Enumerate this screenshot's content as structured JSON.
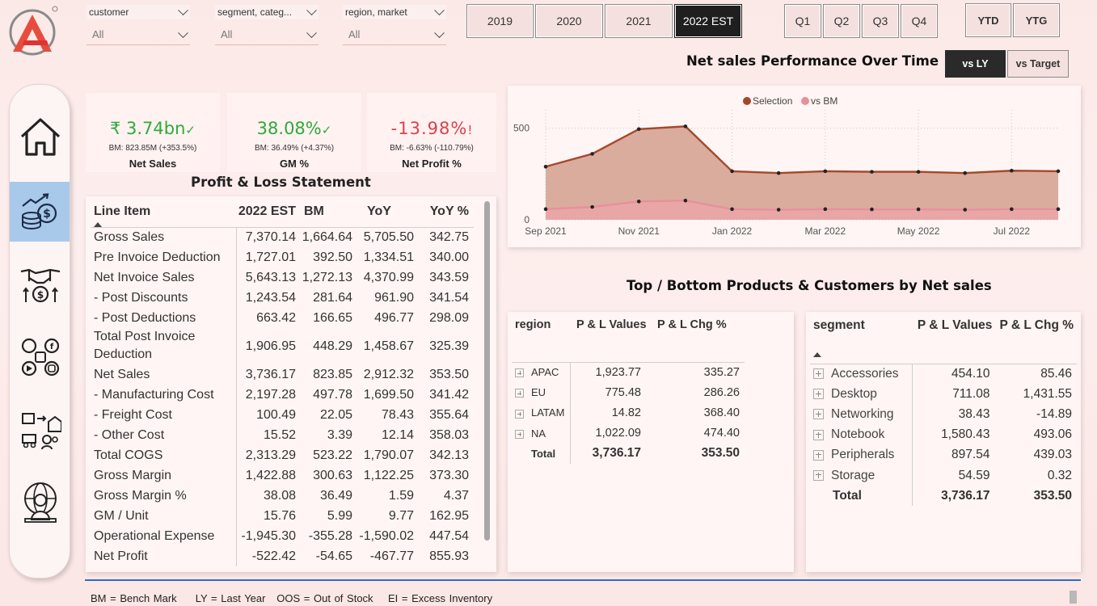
{
  "filters": [
    {
      "label": "customer",
      "value": "All"
    },
    {
      "label": "segment, categ...",
      "value": "All"
    },
    {
      "label": "region, market",
      "value": "All"
    }
  ],
  "years": [
    "2019",
    "2020",
    "2021",
    "2022 EST"
  ],
  "selected_year": "2022 EST",
  "quarters": [
    "Q1",
    "Q2",
    "Q3",
    "Q4"
  ],
  "periods": [
    "YTD",
    "YTG"
  ],
  "compare": {
    "options": [
      "vs LY",
      "vs Target"
    ],
    "selected": "vs LY"
  },
  "kpis": [
    {
      "value": "₹ 3.74bn",
      "indicator": "✓",
      "bm": "BM: 823.85M (+353.5%)",
      "name": "Net Sales",
      "color": "#2eaa3c"
    },
    {
      "value": "38.08%",
      "indicator": "✓",
      "bm": "BM: 36.49% (+4.37%)",
      "name": "GM %",
      "color": "#2eaa3c"
    },
    {
      "value": "-13.98%",
      "indicator": "!",
      "bm": "BM: -6.63% (-110.79%)",
      "name": "Net Profit %",
      "color": "#e0404a"
    }
  ],
  "pl": {
    "title": "Profit & Loss Statement",
    "columns": [
      "Line Item",
      "2022 EST",
      "BM",
      "YoY",
      "YoY %"
    ],
    "rows": [
      [
        "Gross Sales",
        "7,370.14",
        "1,664.64",
        "5,705.50",
        "342.75"
      ],
      [
        "Pre Invoice Deduction",
        "1,727.01",
        "392.50",
        "1,334.51",
        "340.00"
      ],
      [
        "Net Invoice Sales",
        "5,643.13",
        "1,272.13",
        "4,370.99",
        "343.59"
      ],
      [
        "- Post Discounts",
        "1,243.54",
        "281.64",
        "961.90",
        "341.54"
      ],
      [
        "- Post Deductions",
        "663.42",
        "166.65",
        "496.77",
        "298.09"
      ],
      [
        "Total Post Invoice Deduction",
        "1,906.95",
        "448.29",
        "1,458.67",
        "325.39"
      ],
      [
        "Net Sales",
        "3,736.17",
        "823.85",
        "2,912.32",
        "353.50"
      ],
      [
        "- Manufacturing Cost",
        "2,197.28",
        "497.78",
        "1,699.50",
        "341.42"
      ],
      [
        "- Freight Cost",
        "100.49",
        "22.05",
        "78.43",
        "355.64"
      ],
      [
        "- Other Cost",
        "15.52",
        "3.39",
        "12.14",
        "358.03"
      ],
      [
        "Total COGS",
        "2,313.29",
        "523.22",
        "1,790.07",
        "342.13"
      ],
      [
        "Gross Margin",
        "1,422.88",
        "300.63",
        "1,122.25",
        "373.30"
      ],
      [
        "Gross Margin %",
        "38.08",
        "36.49",
        "1.59",
        "4.37"
      ],
      [
        "GM / Unit",
        "15.76",
        "5.99",
        "9.77",
        "162.95"
      ],
      [
        "Operational Expense",
        "-1,945.30",
        "-355.28",
        "-1,590.02",
        "447.54"
      ],
      [
        "Net Profit",
        "-522.42",
        "-54.65",
        "-467.77",
        "855.93"
      ]
    ]
  },
  "chart_title": "Net sales Performance Over Time",
  "chart_data": {
    "type": "area",
    "title": "Net sales Performance Over Time",
    "x": [
      "Sep 2021",
      "Oct 2021",
      "Nov 2021",
      "Dec 2021",
      "Jan 2022",
      "Feb 2022",
      "Mar 2022",
      "Apr 2022",
      "May 2022",
      "Jun 2022",
      "Jul 2022",
      "Aug 2022"
    ],
    "xticks": [
      "Sep 2021",
      "Nov 2021",
      "Jan 2022",
      "Mar 2022",
      "May 2022",
      "Jul 2022"
    ],
    "yticks": [
      0,
      500
    ],
    "ylim": [
      0,
      600
    ],
    "series": [
      {
        "name": "Selection",
        "color": "#a5482a",
        "values": [
          290,
          360,
          495,
          510,
          265,
          255,
          265,
          262,
          262,
          255,
          268,
          265
        ]
      },
      {
        "name": "vs BM",
        "color": "#e8909a",
        "values": [
          58,
          70,
          100,
          105,
          58,
          55,
          58,
          57,
          57,
          55,
          58,
          58
        ]
      }
    ],
    "legend": "top-center"
  },
  "tb_title": "Top / Bottom Products & Customers by Net sales",
  "region_table": {
    "columns": [
      "region",
      "P & L Values",
      "P & L Chg %"
    ],
    "rows": [
      [
        "APAC",
        "1,923.77",
        "335.27"
      ],
      [
        "EU",
        "775.48",
        "286.26"
      ],
      [
        "LATAM",
        "14.82",
        "368.40"
      ],
      [
        "NA",
        "1,022.09",
        "474.40"
      ]
    ],
    "total": [
      "Total",
      "3,736.17",
      "353.50"
    ]
  },
  "segment_table": {
    "columns": [
      "segment",
      "P & L Values",
      "P & L Chg %"
    ],
    "rows": [
      [
        "Accessories",
        "454.10",
        "85.46"
      ],
      [
        "Desktop",
        "711.08",
        "1,431.55"
      ],
      [
        "Networking",
        "38.43",
        "-14.89"
      ],
      [
        "Notebook",
        "1,580.43",
        "493.06"
      ],
      [
        "Peripherals",
        "897.54",
        "439.03"
      ],
      [
        "Storage",
        "54.59",
        "0.32"
      ]
    ],
    "total": [
      "Total",
      "3,736.17",
      "353.50"
    ]
  },
  "footer": "BM = Bench Mark     LY = Last Year   OOS = Out of Stock    EI = Excess Inventory",
  "nav": [
    "home-icon",
    "finance-coins-icon",
    "deal-handshake-icon",
    "social-media-icon",
    "supply-chain-icon",
    "executive-globe-icon"
  ]
}
